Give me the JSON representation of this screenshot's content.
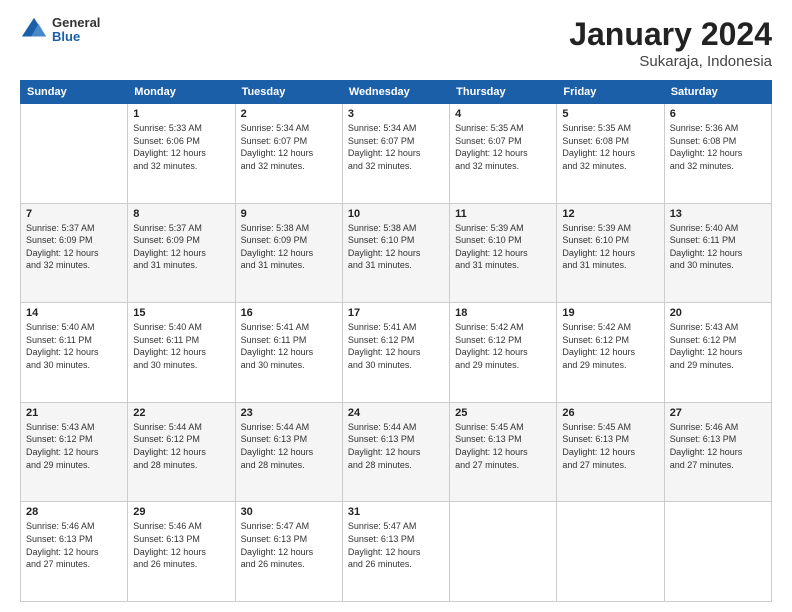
{
  "header": {
    "logo": {
      "general": "General",
      "blue": "Blue"
    },
    "title": "January 2024",
    "location": "Sukaraja, Indonesia"
  },
  "calendar": {
    "weekdays": [
      "Sunday",
      "Monday",
      "Tuesday",
      "Wednesday",
      "Thursday",
      "Friday",
      "Saturday"
    ],
    "weeks": [
      [
        {
          "day": "",
          "info": ""
        },
        {
          "day": "1",
          "info": "Sunrise: 5:33 AM\nSunset: 6:06 PM\nDaylight: 12 hours\nand 32 minutes."
        },
        {
          "day": "2",
          "info": "Sunrise: 5:34 AM\nSunset: 6:07 PM\nDaylight: 12 hours\nand 32 minutes."
        },
        {
          "day": "3",
          "info": "Sunrise: 5:34 AM\nSunset: 6:07 PM\nDaylight: 12 hours\nand 32 minutes."
        },
        {
          "day": "4",
          "info": "Sunrise: 5:35 AM\nSunset: 6:07 PM\nDaylight: 12 hours\nand 32 minutes."
        },
        {
          "day": "5",
          "info": "Sunrise: 5:35 AM\nSunset: 6:08 PM\nDaylight: 12 hours\nand 32 minutes."
        },
        {
          "day": "6",
          "info": "Sunrise: 5:36 AM\nSunset: 6:08 PM\nDaylight: 12 hours\nand 32 minutes."
        }
      ],
      [
        {
          "day": "7",
          "info": "Sunrise: 5:37 AM\nSunset: 6:09 PM\nDaylight: 12 hours\nand 32 minutes."
        },
        {
          "day": "8",
          "info": "Sunrise: 5:37 AM\nSunset: 6:09 PM\nDaylight: 12 hours\nand 31 minutes."
        },
        {
          "day": "9",
          "info": "Sunrise: 5:38 AM\nSunset: 6:09 PM\nDaylight: 12 hours\nand 31 minutes."
        },
        {
          "day": "10",
          "info": "Sunrise: 5:38 AM\nSunset: 6:10 PM\nDaylight: 12 hours\nand 31 minutes."
        },
        {
          "day": "11",
          "info": "Sunrise: 5:39 AM\nSunset: 6:10 PM\nDaylight: 12 hours\nand 31 minutes."
        },
        {
          "day": "12",
          "info": "Sunrise: 5:39 AM\nSunset: 6:10 PM\nDaylight: 12 hours\nand 31 minutes."
        },
        {
          "day": "13",
          "info": "Sunrise: 5:40 AM\nSunset: 6:11 PM\nDaylight: 12 hours\nand 30 minutes."
        }
      ],
      [
        {
          "day": "14",
          "info": "Sunrise: 5:40 AM\nSunset: 6:11 PM\nDaylight: 12 hours\nand 30 minutes."
        },
        {
          "day": "15",
          "info": "Sunrise: 5:40 AM\nSunset: 6:11 PM\nDaylight: 12 hours\nand 30 minutes."
        },
        {
          "day": "16",
          "info": "Sunrise: 5:41 AM\nSunset: 6:11 PM\nDaylight: 12 hours\nand 30 minutes."
        },
        {
          "day": "17",
          "info": "Sunrise: 5:41 AM\nSunset: 6:12 PM\nDaylight: 12 hours\nand 30 minutes."
        },
        {
          "day": "18",
          "info": "Sunrise: 5:42 AM\nSunset: 6:12 PM\nDaylight: 12 hours\nand 29 minutes."
        },
        {
          "day": "19",
          "info": "Sunrise: 5:42 AM\nSunset: 6:12 PM\nDaylight: 12 hours\nand 29 minutes."
        },
        {
          "day": "20",
          "info": "Sunrise: 5:43 AM\nSunset: 6:12 PM\nDaylight: 12 hours\nand 29 minutes."
        }
      ],
      [
        {
          "day": "21",
          "info": "Sunrise: 5:43 AM\nSunset: 6:12 PM\nDaylight: 12 hours\nand 29 minutes."
        },
        {
          "day": "22",
          "info": "Sunrise: 5:44 AM\nSunset: 6:12 PM\nDaylight: 12 hours\nand 28 minutes."
        },
        {
          "day": "23",
          "info": "Sunrise: 5:44 AM\nSunset: 6:13 PM\nDaylight: 12 hours\nand 28 minutes."
        },
        {
          "day": "24",
          "info": "Sunrise: 5:44 AM\nSunset: 6:13 PM\nDaylight: 12 hours\nand 28 minutes."
        },
        {
          "day": "25",
          "info": "Sunrise: 5:45 AM\nSunset: 6:13 PM\nDaylight: 12 hours\nand 27 minutes."
        },
        {
          "day": "26",
          "info": "Sunrise: 5:45 AM\nSunset: 6:13 PM\nDaylight: 12 hours\nand 27 minutes."
        },
        {
          "day": "27",
          "info": "Sunrise: 5:46 AM\nSunset: 6:13 PM\nDaylight: 12 hours\nand 27 minutes."
        }
      ],
      [
        {
          "day": "28",
          "info": "Sunrise: 5:46 AM\nSunset: 6:13 PM\nDaylight: 12 hours\nand 27 minutes."
        },
        {
          "day": "29",
          "info": "Sunrise: 5:46 AM\nSunset: 6:13 PM\nDaylight: 12 hours\nand 26 minutes."
        },
        {
          "day": "30",
          "info": "Sunrise: 5:47 AM\nSunset: 6:13 PM\nDaylight: 12 hours\nand 26 minutes."
        },
        {
          "day": "31",
          "info": "Sunrise: 5:47 AM\nSunset: 6:13 PM\nDaylight: 12 hours\nand 26 minutes."
        },
        {
          "day": "",
          "info": ""
        },
        {
          "day": "",
          "info": ""
        },
        {
          "day": "",
          "info": ""
        }
      ]
    ]
  }
}
